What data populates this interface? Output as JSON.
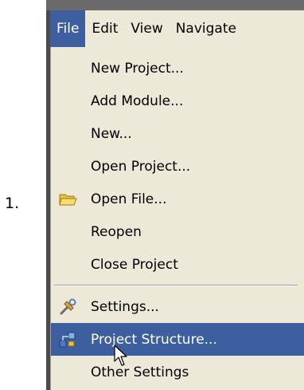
{
  "step_number": "1.",
  "menubar": {
    "items": [
      "File",
      "Edit",
      "View",
      "Navigate"
    ],
    "active": "File"
  },
  "file_menu": {
    "items": [
      {
        "label": "New Project...",
        "icon": ""
      },
      {
        "label": "Add Module...",
        "icon": ""
      },
      {
        "label": "New...",
        "icon": ""
      },
      {
        "label": "Open Project...",
        "icon": ""
      },
      {
        "label": "Open File...",
        "icon": "folder-open-icon"
      },
      {
        "label": "Reopen",
        "icon": ""
      },
      {
        "label": "Close Project",
        "icon": ""
      },
      {
        "label": "Settings...",
        "icon": "settings-tools-icon"
      },
      {
        "label": "Project Structure...",
        "icon": "project-structure-icon",
        "highlighted": true
      },
      {
        "label": "Other Settings",
        "icon": ""
      }
    ]
  },
  "colors": {
    "menu_background": "#ece9d8",
    "highlight": "#3d5f9f",
    "frame": "#4b4b4b"
  }
}
